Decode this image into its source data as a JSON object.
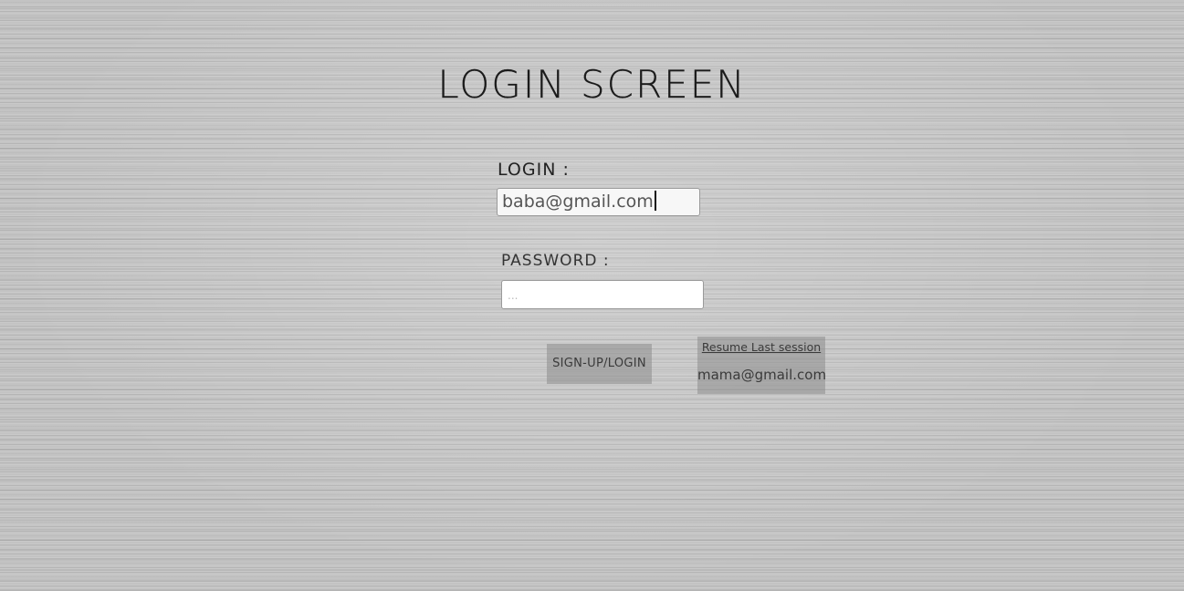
{
  "title": "LOGIN SCREEN",
  "login": {
    "label": "LOGIN :",
    "value": "baba@gmail.com"
  },
  "password": {
    "label": "PASSWORD :",
    "placeholder": "..."
  },
  "buttons": {
    "signup_login": "SIGN-UP/LOGIN",
    "resume_title": "Resume Last session",
    "resume_email": "mama@gmail.com"
  }
}
